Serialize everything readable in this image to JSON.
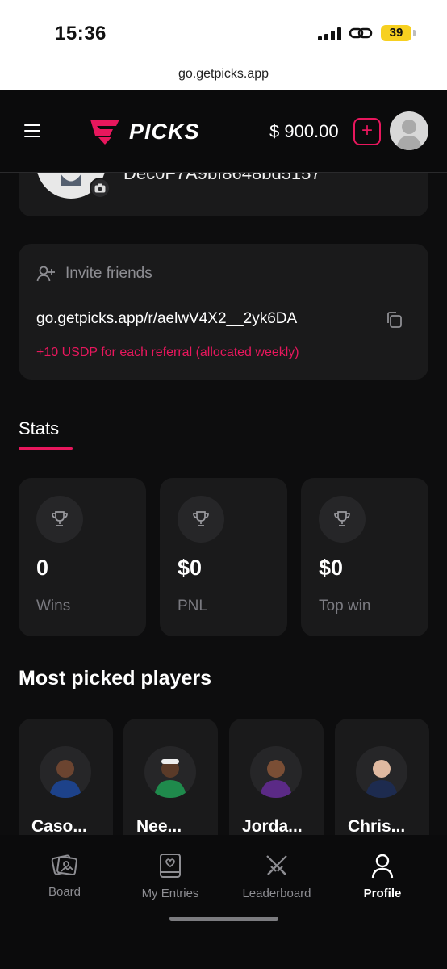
{
  "status_bar": {
    "time": "15:36",
    "battery": "39"
  },
  "browser": {
    "url": "go.getpicks.app"
  },
  "header": {
    "logo_text": "PICKS",
    "balance": "$ 900.00",
    "add_label": "+"
  },
  "profile": {
    "name": "Dec0F7A9bf8648bd5157"
  },
  "invite": {
    "title": "Invite friends",
    "link": "go.getpicks.app/r/aelwV4X2__2yk6DA",
    "note": "+10 USDP for each referral (allocated weekly)"
  },
  "stats": {
    "tab_label": "Stats",
    "cards": [
      {
        "value": "0",
        "label": "Wins"
      },
      {
        "value": "$0",
        "label": "PNL"
      },
      {
        "value": "$0",
        "label": "Top win"
      }
    ]
  },
  "players": {
    "title": "Most picked players",
    "items": [
      {
        "name": "Caso...",
        "jersey": "#1d428a"
      },
      {
        "name": "Nee...",
        "jersey": "#1f8a4c"
      },
      {
        "name": "Jorda...",
        "jersey": "#5b2a86"
      },
      {
        "name": "Chris...",
        "jersey": "#1d2b4f"
      }
    ]
  },
  "nav": {
    "items": [
      {
        "label": "Board",
        "icon": "cards-icon"
      },
      {
        "label": "My Entries",
        "icon": "entries-icon"
      },
      {
        "label": "Leaderboard",
        "icon": "swords-icon"
      },
      {
        "label": "Profile",
        "icon": "person-icon"
      }
    ]
  },
  "colors": {
    "accent": "#e8175d",
    "card": "#1a1a1b",
    "background": "#0d0d0e"
  }
}
